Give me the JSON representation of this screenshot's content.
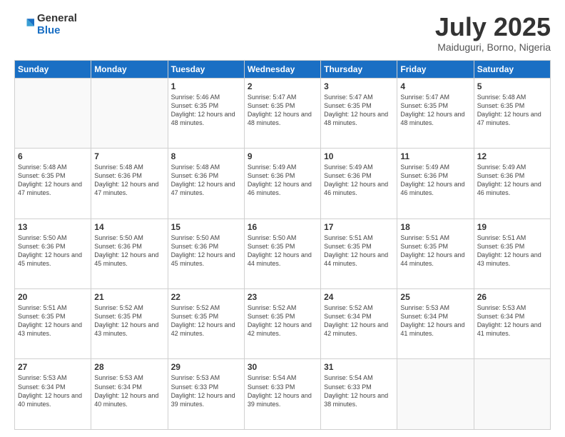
{
  "logo": {
    "general": "General",
    "blue": "Blue"
  },
  "header": {
    "month": "July 2025",
    "location": "Maiduguri, Borno, Nigeria"
  },
  "weekdays": [
    "Sunday",
    "Monday",
    "Tuesday",
    "Wednesday",
    "Thursday",
    "Friday",
    "Saturday"
  ],
  "weeks": [
    [
      {
        "day": "",
        "info": ""
      },
      {
        "day": "",
        "info": ""
      },
      {
        "day": "1",
        "info": "Sunrise: 5:46 AM\nSunset: 6:35 PM\nDaylight: 12 hours and 48 minutes."
      },
      {
        "day": "2",
        "info": "Sunrise: 5:47 AM\nSunset: 6:35 PM\nDaylight: 12 hours and 48 minutes."
      },
      {
        "day": "3",
        "info": "Sunrise: 5:47 AM\nSunset: 6:35 PM\nDaylight: 12 hours and 48 minutes."
      },
      {
        "day": "4",
        "info": "Sunrise: 5:47 AM\nSunset: 6:35 PM\nDaylight: 12 hours and 48 minutes."
      },
      {
        "day": "5",
        "info": "Sunrise: 5:48 AM\nSunset: 6:35 PM\nDaylight: 12 hours and 47 minutes."
      }
    ],
    [
      {
        "day": "6",
        "info": "Sunrise: 5:48 AM\nSunset: 6:35 PM\nDaylight: 12 hours and 47 minutes."
      },
      {
        "day": "7",
        "info": "Sunrise: 5:48 AM\nSunset: 6:36 PM\nDaylight: 12 hours and 47 minutes."
      },
      {
        "day": "8",
        "info": "Sunrise: 5:48 AM\nSunset: 6:36 PM\nDaylight: 12 hours and 47 minutes."
      },
      {
        "day": "9",
        "info": "Sunrise: 5:49 AM\nSunset: 6:36 PM\nDaylight: 12 hours and 46 minutes."
      },
      {
        "day": "10",
        "info": "Sunrise: 5:49 AM\nSunset: 6:36 PM\nDaylight: 12 hours and 46 minutes."
      },
      {
        "day": "11",
        "info": "Sunrise: 5:49 AM\nSunset: 6:36 PM\nDaylight: 12 hours and 46 minutes."
      },
      {
        "day": "12",
        "info": "Sunrise: 5:49 AM\nSunset: 6:36 PM\nDaylight: 12 hours and 46 minutes."
      }
    ],
    [
      {
        "day": "13",
        "info": "Sunrise: 5:50 AM\nSunset: 6:36 PM\nDaylight: 12 hours and 45 minutes."
      },
      {
        "day": "14",
        "info": "Sunrise: 5:50 AM\nSunset: 6:36 PM\nDaylight: 12 hours and 45 minutes."
      },
      {
        "day": "15",
        "info": "Sunrise: 5:50 AM\nSunset: 6:36 PM\nDaylight: 12 hours and 45 minutes."
      },
      {
        "day": "16",
        "info": "Sunrise: 5:50 AM\nSunset: 6:35 PM\nDaylight: 12 hours and 44 minutes."
      },
      {
        "day": "17",
        "info": "Sunrise: 5:51 AM\nSunset: 6:35 PM\nDaylight: 12 hours and 44 minutes."
      },
      {
        "day": "18",
        "info": "Sunrise: 5:51 AM\nSunset: 6:35 PM\nDaylight: 12 hours and 44 minutes."
      },
      {
        "day": "19",
        "info": "Sunrise: 5:51 AM\nSunset: 6:35 PM\nDaylight: 12 hours and 43 minutes."
      }
    ],
    [
      {
        "day": "20",
        "info": "Sunrise: 5:51 AM\nSunset: 6:35 PM\nDaylight: 12 hours and 43 minutes."
      },
      {
        "day": "21",
        "info": "Sunrise: 5:52 AM\nSunset: 6:35 PM\nDaylight: 12 hours and 43 minutes."
      },
      {
        "day": "22",
        "info": "Sunrise: 5:52 AM\nSunset: 6:35 PM\nDaylight: 12 hours and 42 minutes."
      },
      {
        "day": "23",
        "info": "Sunrise: 5:52 AM\nSunset: 6:35 PM\nDaylight: 12 hours and 42 minutes."
      },
      {
        "day": "24",
        "info": "Sunrise: 5:52 AM\nSunset: 6:34 PM\nDaylight: 12 hours and 42 minutes."
      },
      {
        "day": "25",
        "info": "Sunrise: 5:53 AM\nSunset: 6:34 PM\nDaylight: 12 hours and 41 minutes."
      },
      {
        "day": "26",
        "info": "Sunrise: 5:53 AM\nSunset: 6:34 PM\nDaylight: 12 hours and 41 minutes."
      }
    ],
    [
      {
        "day": "27",
        "info": "Sunrise: 5:53 AM\nSunset: 6:34 PM\nDaylight: 12 hours and 40 minutes."
      },
      {
        "day": "28",
        "info": "Sunrise: 5:53 AM\nSunset: 6:34 PM\nDaylight: 12 hours and 40 minutes."
      },
      {
        "day": "29",
        "info": "Sunrise: 5:53 AM\nSunset: 6:33 PM\nDaylight: 12 hours and 39 minutes."
      },
      {
        "day": "30",
        "info": "Sunrise: 5:54 AM\nSunset: 6:33 PM\nDaylight: 12 hours and 39 minutes."
      },
      {
        "day": "31",
        "info": "Sunrise: 5:54 AM\nSunset: 6:33 PM\nDaylight: 12 hours and 38 minutes."
      },
      {
        "day": "",
        "info": ""
      },
      {
        "day": "",
        "info": ""
      }
    ]
  ]
}
